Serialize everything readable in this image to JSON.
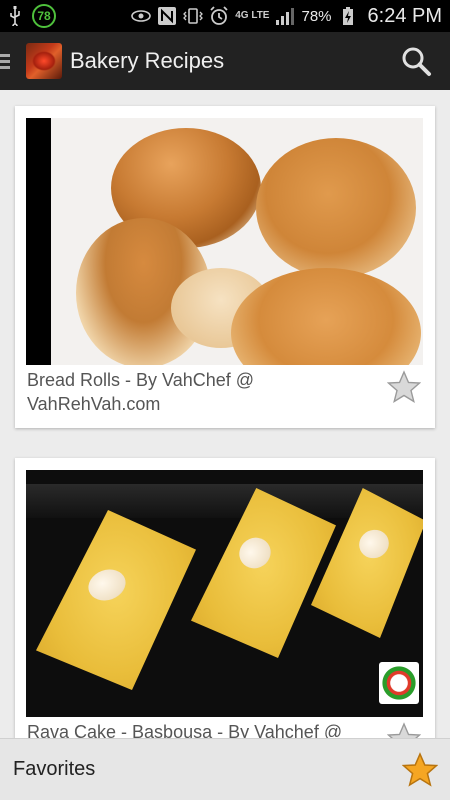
{
  "status_bar": {
    "notification_badge": "78",
    "battery_percent": "78%",
    "network": "4G LTE",
    "time": "6:24 PM",
    "icons": [
      "usb-icon",
      "eye-icon",
      "nfc-icon",
      "vibrate-icon",
      "alarm-icon",
      "signal-icon",
      "battery-charging-icon"
    ]
  },
  "action_bar": {
    "title": "Bakery Recipes",
    "icons": [
      "menu-icon",
      "app-logo",
      "search-icon"
    ]
  },
  "recipes": [
    {
      "title": "Bread Rolls - By VahChef @ VahRehVah.com",
      "favorite": false
    },
    {
      "title": "Rava Cake - Basbousa  - By Vahchef @",
      "favorite": false
    }
  ],
  "bottom_bar": {
    "label": "Favorites",
    "icon": "star-icon"
  },
  "colors": {
    "action_bar_bg": "#222222",
    "status_bar_bg": "#000000",
    "card_bg": "#ffffff",
    "page_bg": "#ececec",
    "favorites_bar_bg": "#e6e6e6",
    "favorite_star": "#f5a623",
    "badge_green": "#4fc13c"
  }
}
